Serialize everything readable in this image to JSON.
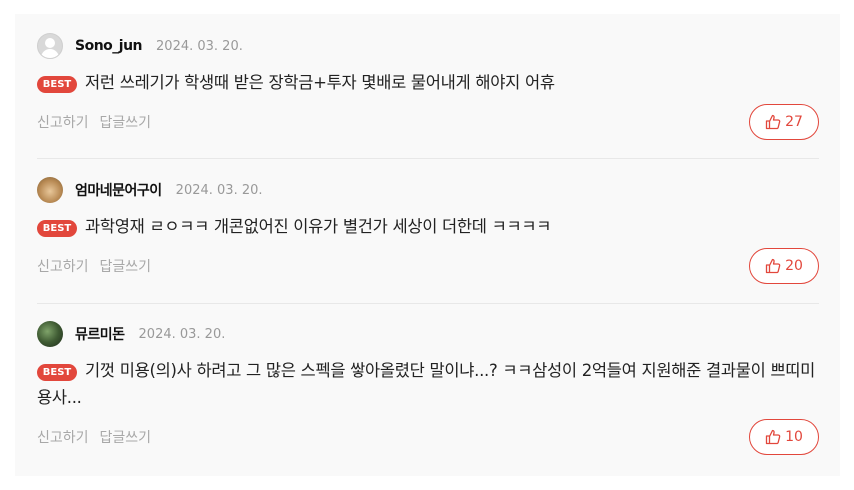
{
  "comments": [
    {
      "nickname": "Sono_jun",
      "date": "2024. 03. 20.",
      "badge": "BEST",
      "text": "저런 쓰레기가 학생때 받은 장학금+투자 몇배로 물어내게 해야지 어휴",
      "report_label": "신고하기",
      "reply_label": "답글쓰기",
      "likes": "27"
    },
    {
      "nickname": "엄마네문어구이",
      "date": "2024. 03. 20.",
      "badge": "BEST",
      "text": "과학영재 ㄹㅇㅋㅋ 개콘없어진 이유가 별건가 세상이 더한데 ㅋㅋㅋㅋ",
      "report_label": "신고하기",
      "reply_label": "답글쓰기",
      "likes": "20"
    },
    {
      "nickname": "뮤르미돈",
      "date": "2024. 03. 20.",
      "badge": "BEST",
      "text": "기껏 미용(의)사 하려고 그 많은 스펙을 쌓아올렸단 말이냐...? ㅋㅋ삼성이 2억들여 지원해준 결과물이 쁘띠미용사...",
      "report_label": "신고하기",
      "reply_label": "답글쓰기",
      "likes": "10"
    }
  ],
  "colors": {
    "accent": "#e2473c",
    "muted": "#999999",
    "panel": "#f9f9f9"
  },
  "icons": {
    "like": "thumbs-up-icon",
    "avatar_default": "user-silhouette-icon"
  }
}
